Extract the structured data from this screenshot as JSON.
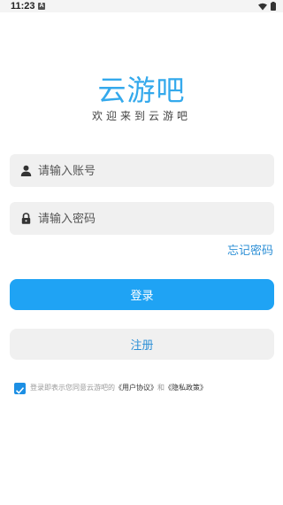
{
  "status_bar": {
    "time": "11:23",
    "notification": "A"
  },
  "brand": {
    "logo_text": "云游吧",
    "slogan": "欢迎来到云游吧"
  },
  "account_field": {
    "placeholder": "请输入账号",
    "value": ""
  },
  "password_field": {
    "placeholder": "请输入密码",
    "value": ""
  },
  "forgot_password_label": "忘记密码",
  "login_button_label": "登录",
  "register_button_label": "注册",
  "agreement": {
    "checked": true,
    "prefix": "登录即表示您同意云游吧的",
    "user_agreement": "《用户协议》",
    "conjunction": "和",
    "privacy_policy": "《隐私政策》"
  },
  "colors": {
    "accent": "#1fa3f4",
    "logo": "#34a9ec",
    "link": "#2c8fd6",
    "field_bg": "#f0f0f0"
  }
}
